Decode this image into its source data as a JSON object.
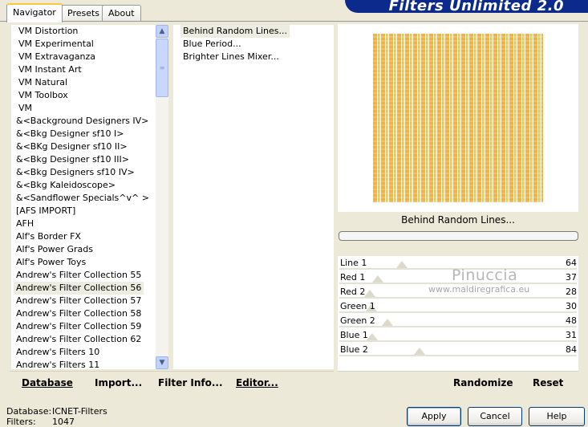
{
  "tabs": [
    "Navigator",
    "Presets",
    "About"
  ],
  "banner": "Filters Unlimited 2.0",
  "categories": [
    "VM Distortion",
    "VM Experimental",
    "VM Extravaganza",
    "VM Instant Art",
    "VM Natural",
    "VM Toolbox",
    "VM",
    "&<Background Designers IV>",
    "&<Bkg Designer sf10 I>",
    "&<BKg Designer sf10 II>",
    "&<Bkg Designer sf10 III>",
    "&<Bkg Designers sf10 IV>",
    "&<Bkg Kaleidoscope>",
    "&<Sandflower Specials^v^ >",
    "[AFS IMPORT]",
    "AFH",
    "Alf's Border FX",
    "Alf's Power Grads",
    "Alf's Power Toys",
    "Andrew's Filter Collection 55",
    "Andrew's Filter Collection 56",
    "Andrew's Filter Collection 57",
    "Andrew's Filter Collection 58",
    "Andrew's Filter Collection 59",
    "Andrew's Filter Collection 62",
    "Andrew's Filters 10",
    "Andrew's Filters 11"
  ],
  "selected_category_index": 20,
  "filters": [
    "Behind Random Lines...",
    "Blue Period...",
    "Brighter Lines Mixer..."
  ],
  "selected_filter_index": 0,
  "buttons": {
    "database": "Database",
    "import": "Import...",
    "filter_info": "Filter Info...",
    "editor": "Editor...",
    "randomize": "Randomize",
    "reset": "Reset",
    "apply": "Apply",
    "cancel": "Cancel",
    "help": "Help"
  },
  "filter_title": "Behind Random Lines...",
  "sliders": [
    {
      "label": "Line 1",
      "value": 64
    },
    {
      "label": "Red 1",
      "value": 37
    },
    {
      "label": "Red 2",
      "value": 28
    },
    {
      "label": "Green 1",
      "value": 30
    },
    {
      "label": "Green 2",
      "value": 48
    },
    {
      "label": "Blue 1",
      "value": 31
    },
    {
      "label": "Blue 2",
      "value": 84
    }
  ],
  "watermark": {
    "name": "Pinuccia",
    "site": "www.maidiregrafica.eu"
  },
  "footer": {
    "database_label": "Database:",
    "database_value": "ICNET-Filters",
    "filters_label": "Filters:",
    "filters_value": "1047"
  },
  "icons": {
    "scroll_up": "chevron-up-icon",
    "scroll_down": "chevron-down-icon"
  }
}
